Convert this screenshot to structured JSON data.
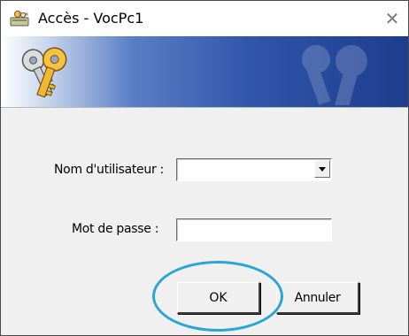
{
  "window": {
    "title": "Accès - VocPc1",
    "close_symbol": "✕",
    "app_icon": "keys-drive-icon",
    "banner_icon": "keys-icon"
  },
  "form": {
    "user_label": "Nom d'utilisateur :",
    "user_value": "",
    "password_label": "Mot de passe :",
    "password_value": ""
  },
  "buttons": {
    "ok_label": "OK",
    "cancel_label": "Annuler"
  },
  "colors": {
    "banner_start": "#ffffff",
    "banner_end": "#1e3d8c",
    "highlight": "#2aa6d6"
  }
}
